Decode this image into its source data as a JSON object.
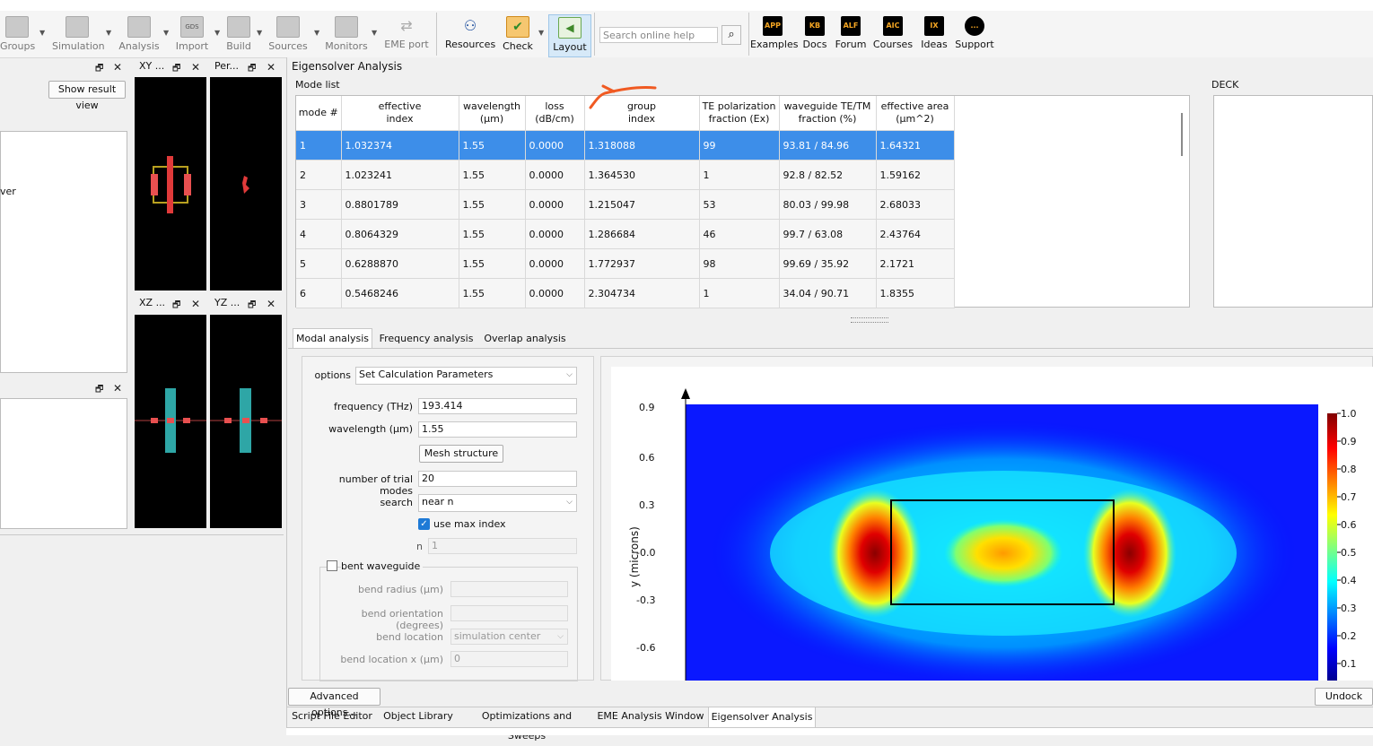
{
  "toolbar": {
    "items": [
      {
        "label": "Groups"
      },
      {
        "label": "Simulation"
      },
      {
        "label": "Analysis"
      },
      {
        "label": "Import",
        "icon_text": "GDS"
      },
      {
        "label": "Build"
      },
      {
        "label": "Sources"
      },
      {
        "label": "Monitors"
      },
      {
        "label": "EME port"
      }
    ],
    "resources_label": "Resources",
    "check_label": "Check",
    "layout_label": "Layout",
    "search_placeholder": "Search online help",
    "badges": [
      {
        "icon_text": "APP",
        "label": "Examples"
      },
      {
        "icon_text": "KB",
        "label": "Docs"
      },
      {
        "icon_text": "ALF",
        "label": "Forum"
      },
      {
        "icon_text": "AIC",
        "label": "Courses"
      },
      {
        "icon_text": "IX",
        "label": "Ideas"
      },
      {
        "icon_text": "...",
        "label": "Support"
      }
    ]
  },
  "left": {
    "show_result_view": "Show result view",
    "partial_text": "ver",
    "views": {
      "xy": "XY ...",
      "per": "Per...",
      "xz": "XZ ...",
      "yz": "YZ ..."
    }
  },
  "eigensolver": {
    "title": "Eigensolver Analysis",
    "mode_list_label": "Mode list",
    "deck_label": "DECK",
    "columns": [
      [
        "mode #"
      ],
      [
        "effective",
        "index"
      ],
      [
        "wavelength",
        "(µm)"
      ],
      [
        "loss",
        "(dB/cm)"
      ],
      [
        "group",
        "index"
      ],
      [
        "TE polarization",
        "fraction (Ex)"
      ],
      [
        "waveguide TE/TM",
        "fraction (%)"
      ],
      [
        "effective area",
        "(µm^2)"
      ]
    ],
    "rows": [
      [
        "1",
        "1.032374",
        "1.55",
        "0.0000",
        "1.318088",
        "99",
        "93.81 / 84.96",
        "1.64321"
      ],
      [
        "2",
        "1.023241",
        "1.55",
        "0.0000",
        "1.364530",
        "1",
        "92.8 / 82.52",
        "1.59162"
      ],
      [
        "3",
        "0.8801789",
        "1.55",
        "0.0000",
        "1.215047",
        "53",
        "80.03 / 99.98",
        "2.68033"
      ],
      [
        "4",
        "0.8064329",
        "1.55",
        "0.0000",
        "1.286684",
        "46",
        "99.7 / 63.08",
        "2.43764"
      ],
      [
        "5",
        "0.6288870",
        "1.55",
        "0.0000",
        "1.772937",
        "98",
        "99.69 / 35.92",
        "2.1721"
      ],
      [
        "6",
        "0.5468246",
        "1.55",
        "0.0000",
        "2.304734",
        "1",
        "34.04 / 90.71",
        "1.8355"
      ]
    ],
    "selected_row": 0
  },
  "analysis_tabs": [
    "Modal analysis",
    "Frequency analysis",
    "Overlap analysis"
  ],
  "form": {
    "options_label": "options",
    "options_value": "Set Calculation Parameters",
    "frequency_label": "frequency (THz)",
    "frequency_value": "193.414",
    "wavelength_label": "wavelength (µm)",
    "wavelength_value": "1.55",
    "mesh_button": "Mesh structure",
    "trial_modes_label": "number of trial modes",
    "trial_modes_value": "20",
    "search_label": "search",
    "search_value": "near n",
    "use_max_index_label": "use max index",
    "n_label": "n",
    "n_value": "1",
    "bent_label": "bent waveguide",
    "bend_radius_label": "bend radius (µm)",
    "bend_orientation_label": "bend orientation (degrees)",
    "bend_location_label": "bend location",
    "bend_location_value": "simulation center",
    "bend_location_x_label": "bend location x (µm)",
    "bend_location_x_value": "0"
  },
  "plot": {
    "ylabel": "y (microns)",
    "yticks": [
      "0.9",
      "0.6",
      "0.3",
      "-0.0",
      "-0.3",
      "-0.6"
    ],
    "colorbar_ticks": [
      "1.0",
      "0.9",
      "0.8",
      "0.7",
      "0.6",
      "0.5",
      "0.4",
      "0.3",
      "0.2",
      "0.1"
    ]
  },
  "advanced_button": "Advanced options...",
  "undock_button": "Undock",
  "bottom_tabs": [
    "Script File Editor",
    "Object Library",
    "Optimizations and Sweeps",
    "EME Analysis Window",
    "Eigensolver Analysis"
  ],
  "colors": {
    "selection": "#3d8ee9",
    "accent_check": "#f0a030"
  }
}
